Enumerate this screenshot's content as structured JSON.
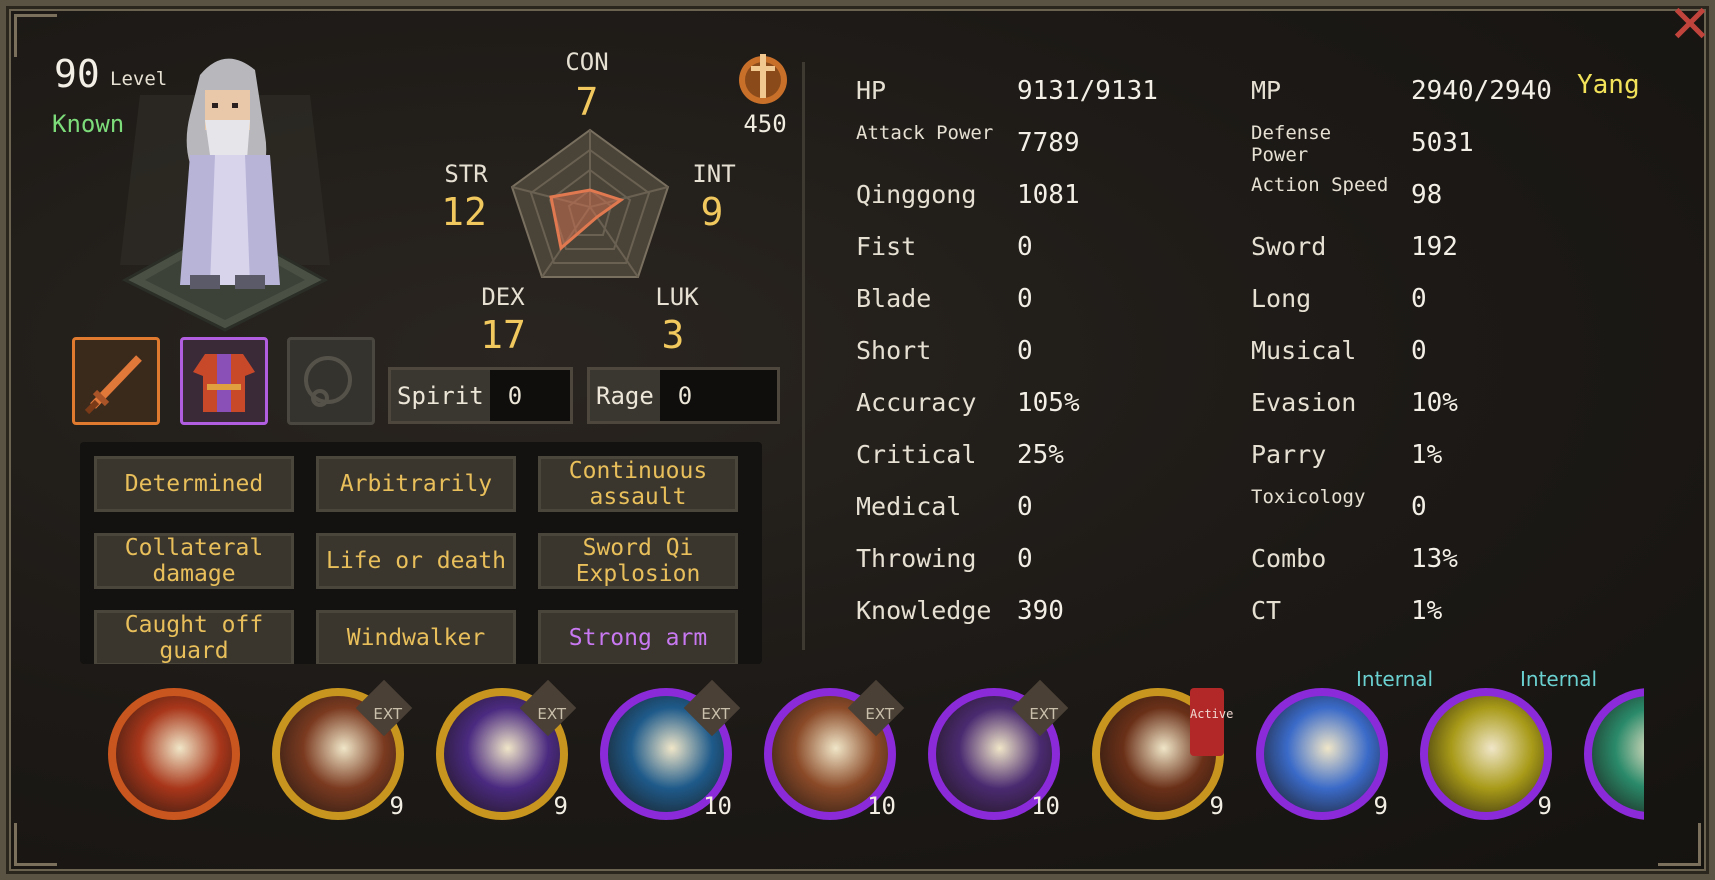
{
  "character": {
    "level": "90",
    "level_label": "Level",
    "status": "Known"
  },
  "stats": {
    "con": {
      "label": "CON",
      "value": "7"
    },
    "str": {
      "label": "STR",
      "value": "12"
    },
    "int": {
      "label": "INT",
      "value": "9"
    },
    "dex": {
      "label": "DEX",
      "value": "17"
    },
    "luk": {
      "label": "LUK",
      "value": "3"
    }
  },
  "medal_value": "450",
  "spirit": {
    "label": "Spirit",
    "value": "0"
  },
  "rage": {
    "label": "Rage",
    "value": "0"
  },
  "traits": [
    {
      "label": "Determined",
      "color": "#e8bf5a"
    },
    {
      "label": "Arbitrarily",
      "color": "#e8bf5a"
    },
    {
      "label": "Continuous assault",
      "color": "#e8bf5a"
    },
    {
      "label": "Collateral damage",
      "color": "#e8bf5a"
    },
    {
      "label": "Life or death",
      "color": "#e8bf5a"
    },
    {
      "label": "Sword Qi Explosion",
      "color": "#e8bf5a"
    },
    {
      "label": "Caught off guard",
      "color": "#e8bf5a"
    },
    {
      "label": "Windwalker",
      "color": "#e8bf5a"
    },
    {
      "label": "Strong arm",
      "color": "#c878f0"
    }
  ],
  "attributes_left": [
    {
      "label": "HP",
      "value": "9131/9131"
    },
    {
      "label": "Attack Power",
      "value": "7789"
    },
    {
      "label": "Qinggong",
      "value": "1081"
    },
    {
      "label": "Fist",
      "value": "0"
    },
    {
      "label": "Blade",
      "value": "0"
    },
    {
      "label": "Short",
      "value": "0"
    },
    {
      "label": "Accuracy",
      "value": "105%"
    },
    {
      "label": "Critical",
      "value": "25%"
    },
    {
      "label": "Medical",
      "value": "0"
    },
    {
      "label": "Throwing",
      "value": "0"
    },
    {
      "label": "Knowledge",
      "value": "390"
    }
  ],
  "attributes_right": [
    {
      "label": "MP",
      "value": "2940/2940"
    },
    {
      "label": "Defense Power",
      "value": "5031"
    },
    {
      "label": "Action Speed",
      "value": "98"
    },
    {
      "label": "Sword",
      "value": "192"
    },
    {
      "label": "Long",
      "value": "0"
    },
    {
      "label": "Musical",
      "value": "0"
    },
    {
      "label": "Evasion",
      "value": "10%"
    },
    {
      "label": "Parry",
      "value": "1%"
    },
    {
      "label": "Toxicology",
      "value": "0"
    },
    {
      "label": "Combo",
      "value": "13%"
    },
    {
      "label": "CT",
      "value": "1%"
    }
  ],
  "affinity": "Yang",
  "skills": [
    {
      "level": "",
      "tag": "",
      "ring": "#c8561e",
      "fill": "#a8361a",
      "icon": "claw-slash-icon"
    },
    {
      "level": "9",
      "tag": "EXT",
      "ring": "#c8961e",
      "fill": "#7a3a20",
      "icon": "sword-strike-icon"
    },
    {
      "level": "9",
      "tag": "EXT",
      "ring": "#c8961e",
      "fill": "#4a2a80",
      "icon": "purple-slash-icon"
    },
    {
      "level": "10",
      "tag": "EXT",
      "ring": "#8a2ad8",
      "fill": "#1e5a8a",
      "icon": "ice-slash-icon"
    },
    {
      "level": "10",
      "tag": "EXT",
      "ring": "#8a2ad8",
      "fill": "#8a4a28",
      "icon": "golden-spear-icon"
    },
    {
      "level": "10",
      "tag": "EXT",
      "ring": "#8a2ad8",
      "fill": "#4a2a70",
      "icon": "lightning-burst-icon"
    },
    {
      "level": "9",
      "tag": "Active",
      "ring": "#c8961e",
      "fill": "#6a3018",
      "icon": "fire-wave-icon"
    },
    {
      "level": "9",
      "tag": "Internal",
      "ring": "#8a2ad8",
      "fill": "#3a6ac8",
      "icon": "ice-crystal-icon"
    },
    {
      "level": "9",
      "tag": "Internal",
      "ring": "#8a2ad8",
      "fill": "#a89a18",
      "icon": "golden-orb-icon"
    },
    {
      "level": "",
      "tag": "",
      "ring": "#8a2ad8",
      "fill": "#2a8a6a",
      "icon": "green-skill-icon"
    }
  ]
}
